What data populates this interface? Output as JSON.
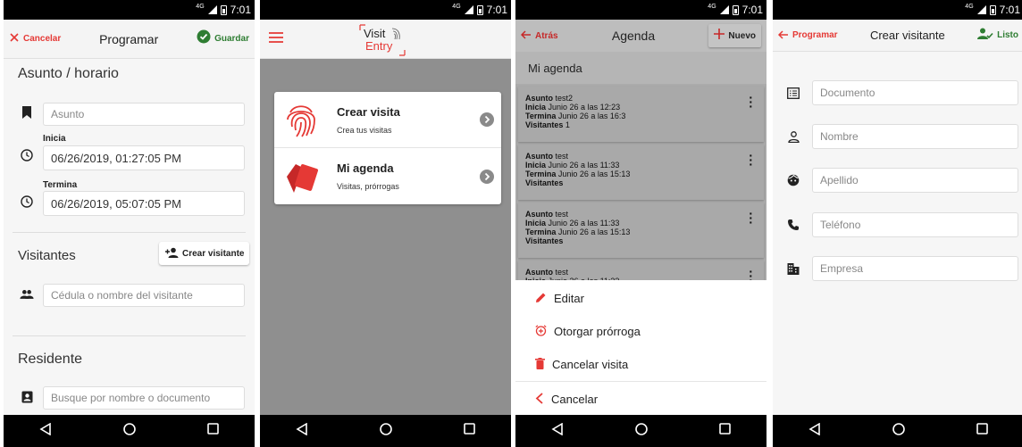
{
  "status": {
    "time": "7:01"
  },
  "screen1": {
    "cancel_label": "Cancelar",
    "title": "Programar",
    "save_label": "Guardar",
    "section_schedule": "Asunto / horario",
    "subject_placeholder": "Asunto",
    "start_label": "Inicia",
    "start_value": "06/26/2019, 01:27:05 PM",
    "end_label": "Termina",
    "end_value": "06/26/2019, 05:07:05 PM",
    "section_visitors": "Visitantes",
    "create_visitor_label": "Crear visitante",
    "visitor_placeholder": "Cédula o nombre del visitante",
    "section_resident": "Residente",
    "resident_placeholder": "Busque por nombre o documento"
  },
  "screen2": {
    "logo_line1": "Visit",
    "logo_line2": "Entry",
    "menu": [
      {
        "title": "Crear visita",
        "subtitle": "Crea tus visitas"
      },
      {
        "title": "Mi agenda",
        "subtitle": "Visitas, prórrogas"
      }
    ]
  },
  "screen3": {
    "back_label": "Atrás",
    "title": "Agenda",
    "new_label": "Nuevo",
    "header": "Mi agenda",
    "labels": {
      "subject": "Asunto",
      "start": "Inicia",
      "end": "Termina",
      "visitors": "Visitantes"
    },
    "items": [
      {
        "subject": "test2",
        "start": "Junio 26 a las 12:23",
        "end": "Junio 26 a las 16:3",
        "visitors": "1"
      },
      {
        "subject": "test",
        "start": "Junio 26 a las 11:33",
        "end": "Junio 26 a las 15:13",
        "visitors": ""
      },
      {
        "subject": "test",
        "start": "Junio 26 a las 11:33",
        "end": "Junio 26 a las 15:13",
        "visitors": ""
      },
      {
        "subject": "test",
        "start": "Junio 26 a las 11:33",
        "end": "",
        "visitors": ""
      }
    ],
    "sheet": {
      "edit": "Editar",
      "extend": "Otorgar prórroga",
      "cancel_visit": "Cancelar visita",
      "cancel": "Cancelar"
    }
  },
  "screen4": {
    "back_label": "Programar",
    "title": "Crear visitante",
    "done_label": "Listo",
    "fields": {
      "document": "Documento",
      "name": "Nombre",
      "lastname": "Apellido",
      "phone": "Teléfono",
      "company": "Empresa"
    }
  },
  "colors": {
    "accent": "#e53935",
    "success": "#2e7d32",
    "dark": "#222222"
  }
}
